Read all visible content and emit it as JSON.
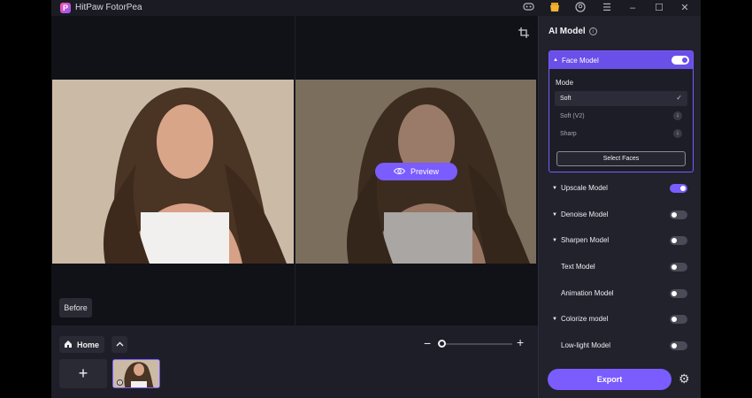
{
  "app": {
    "title": "HitPaw FotorPea",
    "logo_letter": "P"
  },
  "titlebar_icons": [
    "discord-icon",
    "shop-icon",
    "account-icon",
    "menu-icon",
    "minimize-icon",
    "maximize-icon",
    "close-icon"
  ],
  "canvas": {
    "preview_label": "Preview",
    "before_label": "Before"
  },
  "bottom": {
    "home_label": "Home",
    "add_label": "+"
  },
  "panel": {
    "title": "AI Model",
    "face_model": {
      "label": "Face Model",
      "enabled": true,
      "mode_label": "Mode",
      "options": [
        {
          "label": "Soft",
          "selected": true,
          "state": "selected"
        },
        {
          "label": "Soft (V2)",
          "selected": false,
          "state": "download"
        },
        {
          "label": "Sharp",
          "selected": false,
          "state": "download"
        }
      ],
      "select_faces_label": "Select Faces"
    },
    "models": [
      {
        "label": "Upscale Model",
        "enabled": true,
        "expandable": true
      },
      {
        "label": "Denoise Model",
        "enabled": false,
        "expandable": true
      },
      {
        "label": "Sharpen Model",
        "enabled": false,
        "expandable": true
      },
      {
        "label": "Text Model",
        "enabled": false,
        "expandable": false
      },
      {
        "label": "Animation Model",
        "enabled": false,
        "expandable": false
      },
      {
        "label": "Colorize model",
        "enabled": false,
        "expandable": true
      },
      {
        "label": "Low-light Model",
        "enabled": false,
        "expandable": false
      }
    ],
    "export_label": "Export"
  },
  "colors": {
    "accent": "#7a5cff",
    "panel_bg": "#22222c",
    "canvas_bg": "#111118"
  }
}
